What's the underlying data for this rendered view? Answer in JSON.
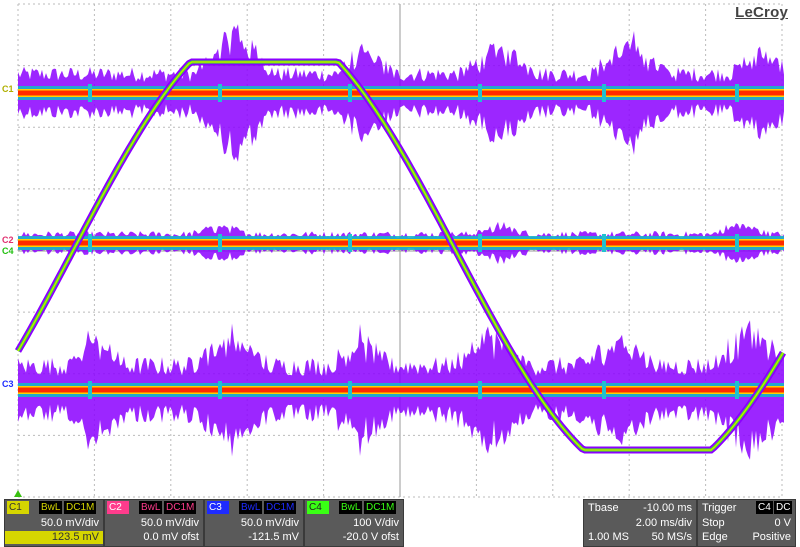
{
  "brand": "LeCroy",
  "colors": {
    "c1": "#d6d600",
    "c2": "#ff3c8c",
    "c3": "#1e2bff",
    "c4": "#39ff14",
    "panel_bg": "#5a5a5a",
    "trace_core": "#ff2a00",
    "trace_halo": "#8b00ff"
  },
  "grid": {
    "h_divisions": 10,
    "v_divisions": 8
  },
  "markers": {
    "c1": "C1",
    "c2": "C2",
    "c3": "C3",
    "c4": "C4"
  },
  "channels": [
    {
      "name": "C1",
      "bwl": "BwL",
      "coupling": "DC1M",
      "scale": "50.0 mV/div",
      "offset": "123.5 mV"
    },
    {
      "name": "C2",
      "bwl": "BwL",
      "coupling": "DC1M",
      "scale": "50.0 mV/div",
      "offset": "0.0 mV ofst"
    },
    {
      "name": "C3",
      "bwl": "BwL",
      "coupling": "DC1M",
      "scale": "50.0 mV/div",
      "offset": "-121.5 mV"
    },
    {
      "name": "C4",
      "bwl": "BwL",
      "coupling": "DC1M",
      "scale": "100 V/div",
      "offset": "-20.0 V ofst"
    }
  ],
  "timebase": {
    "label": "Tbase",
    "delay": "-10.00 ms",
    "scale": "2.00 ms/div",
    "points": "1.00 MS",
    "rate": "50 MS/s"
  },
  "trigger": {
    "label": "Trigger",
    "source": "C4",
    "coupling": "DC",
    "mode": "Stop",
    "level": "0 V",
    "type": "Edge",
    "slope": "Positive"
  }
}
